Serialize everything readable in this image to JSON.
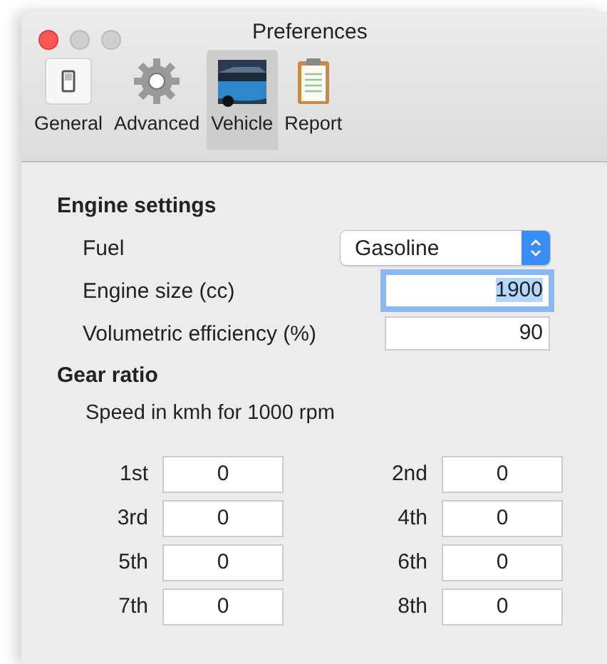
{
  "window": {
    "title": "Preferences"
  },
  "tabs": [
    {
      "label": "General",
      "selected": false
    },
    {
      "label": "Advanced",
      "selected": false
    },
    {
      "label": "Vehicle",
      "selected": true
    },
    {
      "label": "Report",
      "selected": false
    }
  ],
  "engine": {
    "title": "Engine settings",
    "fields": [
      {
        "kind": "popup",
        "label": "Fuel",
        "value": "Gasoline"
      },
      {
        "kind": "text",
        "label": "Engine size (cc)",
        "value": "1900",
        "focused": true
      },
      {
        "kind": "text",
        "label": "Volumetric efficiency (%)",
        "value": "90",
        "focused": false
      }
    ]
  },
  "gears": {
    "title": "Gear ratio",
    "hint": "Speed in kmh for 1000 rpm",
    "items": [
      {
        "label": "1st",
        "value": "0"
      },
      {
        "label": "2nd",
        "value": "0"
      },
      {
        "label": "3rd",
        "value": "0"
      },
      {
        "label": "4th",
        "value": "0"
      },
      {
        "label": "5th",
        "value": "0"
      },
      {
        "label": "6th",
        "value": "0"
      },
      {
        "label": "7th",
        "value": "0"
      },
      {
        "label": "8th",
        "value": "0"
      }
    ]
  }
}
